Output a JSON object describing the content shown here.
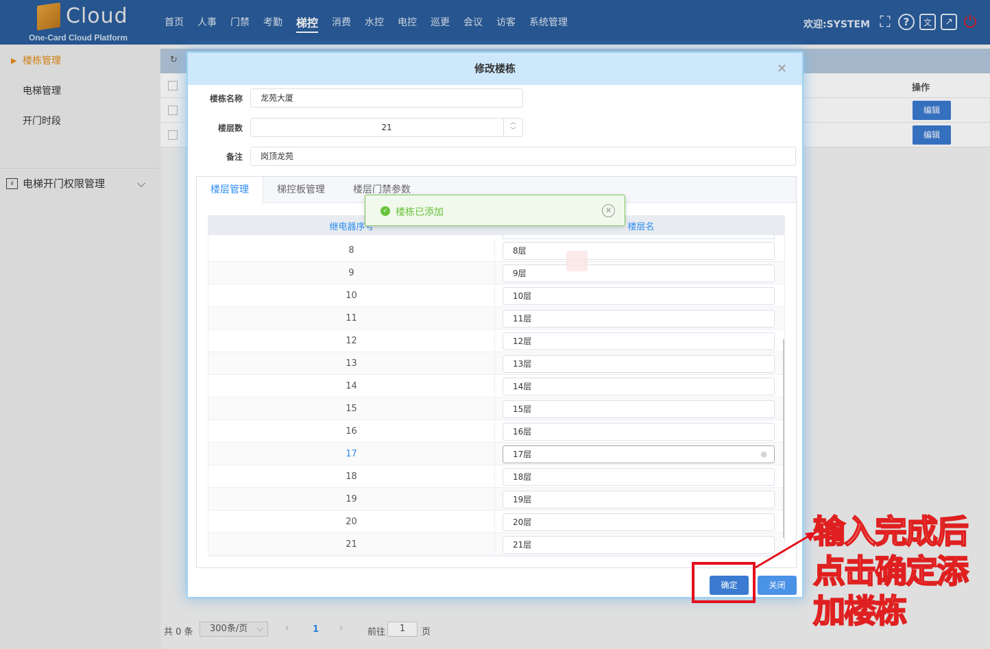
{
  "header": {
    "logo_word": "Cloud",
    "logo_sub": "One-Card Cloud Platform",
    "nav": [
      "首页",
      "人事",
      "门禁",
      "考勤",
      "梯控",
      "消费",
      "水控",
      "电控",
      "巡更",
      "会议",
      "访客",
      "系统管理"
    ],
    "active_nav": "梯控",
    "welcome": "欢迎:SYSTEM",
    "icons": [
      "fullscreen-icon",
      "help-icon",
      "language-icon",
      "external-link-icon",
      "power-icon"
    ]
  },
  "sidebar": {
    "items": [
      {
        "label": "楼栋管理",
        "active": true
      },
      {
        "label": "电梯管理",
        "active": false
      },
      {
        "label": "开门时段",
        "active": false
      }
    ],
    "group": "电梯开门权限管理"
  },
  "main": {
    "op_header": "操作",
    "edit_label": "编辑"
  },
  "pager": {
    "total": "共 0 条",
    "page_size": "300条/页",
    "current_page": "1",
    "goto_label": "前往",
    "goto_value": "1",
    "page_suffix": "页"
  },
  "dialog": {
    "title": "修改楼栋",
    "name_label": "楼栋名称",
    "name_value": "龙苑大厦",
    "floors_label": "楼层数",
    "floors_value": "21",
    "remark_label": "备注",
    "remark_value": "岗顶龙苑",
    "tabs": [
      "楼层管理",
      "梯控板管理",
      "楼层门禁参数"
    ],
    "col_relay": "继电器序号",
    "col_floor": "楼层名",
    "rows": [
      {
        "num": "8",
        "name": "8层"
      },
      {
        "num": "9",
        "name": "9层"
      },
      {
        "num": "10",
        "name": "10层"
      },
      {
        "num": "11",
        "name": "11层"
      },
      {
        "num": "12",
        "name": "12层"
      },
      {
        "num": "13",
        "name": "13层"
      },
      {
        "num": "14",
        "name": "14层"
      },
      {
        "num": "15",
        "name": "15层"
      },
      {
        "num": "16",
        "name": "16层"
      },
      {
        "num": "17",
        "name": "17层"
      },
      {
        "num": "18",
        "name": "18层"
      },
      {
        "num": "19",
        "name": "19层"
      },
      {
        "num": "20",
        "name": "20层"
      },
      {
        "num": "21",
        "name": "21层"
      }
    ],
    "ok_label": "确定",
    "close_label": "关闭"
  },
  "toast": {
    "message": "楼栋已添加"
  },
  "annotation": {
    "line1": "输入完成后",
    "line2": "点击确定添",
    "line3": "加楼栋"
  },
  "colors": {
    "header": "#2a5d9c",
    "accent": "#2d8cf0",
    "success": "#67c23a",
    "annotation_red": "#e3101c",
    "sidebar_active": "#e28b14"
  }
}
